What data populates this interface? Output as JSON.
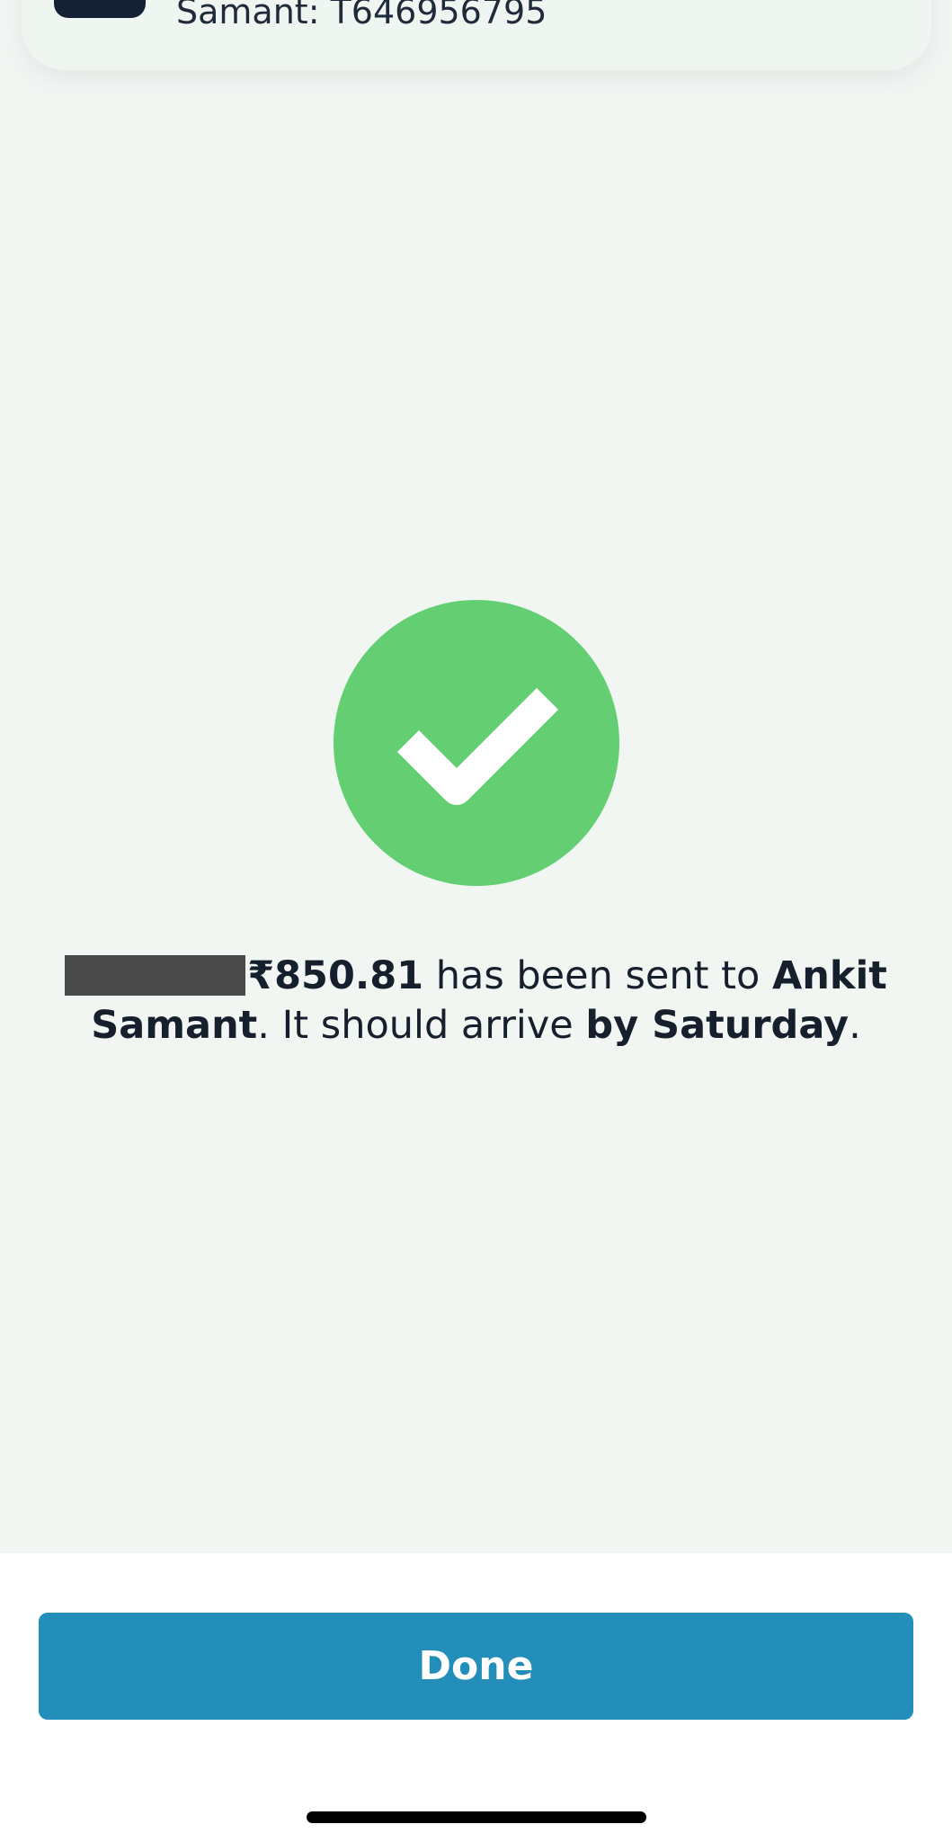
{
  "header_card": {
    "reference_text": "Samant: T646956795",
    "icon": "account-icon"
  },
  "status": {
    "icon": "success-check-icon",
    "color": "#64cf72"
  },
  "message": {
    "amount": "₹850.81",
    "text_1": " has been sent to ",
    "recipient": "Ankit Samant",
    "text_2": ". It should arrive ",
    "arrival": "by Saturday",
    "text_3": "."
  },
  "actions": {
    "done_label": "Done",
    "button_color": "#238eb9"
  }
}
